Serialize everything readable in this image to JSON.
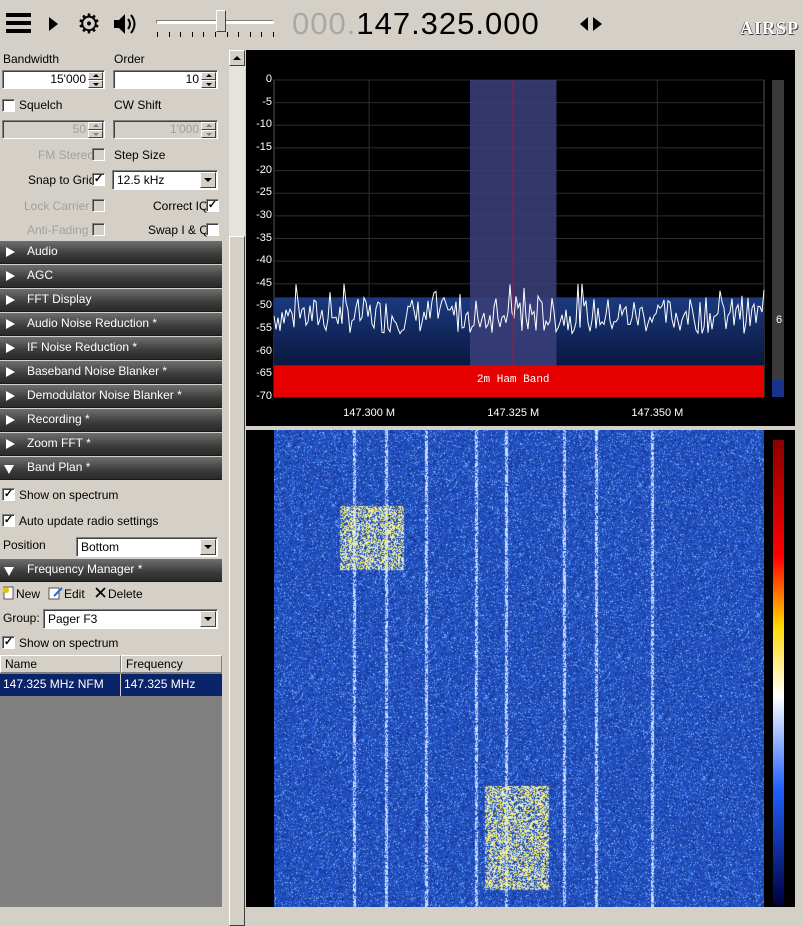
{
  "toolbar": {
    "freq_dim": "000.",
    "freq_main": "147.325.000",
    "brand": "AIRSP",
    "volume_level": 0.55
  },
  "settings": {
    "bandwidth_label": "Bandwidth",
    "bandwidth_value": "15'000",
    "order_label": "Order",
    "order_value": "10",
    "squelch_label": "Squelch",
    "squelch_checked": false,
    "squelch_value": "50",
    "cw_shift_label": "CW Shift",
    "cw_shift_value": "1'000",
    "fm_stereo_label": "FM Stereo",
    "step_size_label": "Step Size",
    "snap_label": "Snap to Grid",
    "snap_checked": true,
    "step_value": "12.5 kHz",
    "lock_carrier_label": "Lock Carrier",
    "correct_iq_label": "Correct IQ",
    "correct_iq_checked": true,
    "anti_fading_label": "Anti-Fading",
    "swap_iq_label": "Swap I & Q"
  },
  "sections": [
    "Audio",
    "AGC",
    "FFT Display",
    "Audio Noise Reduction *",
    "IF Noise Reduction *",
    "Baseband Noise Blanker *",
    "Demodulator Noise Blanker *",
    "Recording *",
    "Zoom FFT *",
    "Band Plan *"
  ],
  "band_plan": {
    "show_on_spectrum": "Show on spectrum",
    "auto_update": "Auto update radio settings",
    "position_label": "Position",
    "position_value": "Bottom"
  },
  "freq_manager": {
    "title": "Frequency Manager *",
    "new_label": "New",
    "edit_label": "Edit",
    "delete_label": "Delete",
    "group_label": "Group:",
    "group_value": "Pager F3",
    "show_on_spectrum": "Show on spectrum",
    "columns": [
      "Name",
      "Frequency"
    ],
    "rows": [
      {
        "name": "147.325 MHz NFM",
        "frequency": "147.325 MHz"
      }
    ]
  },
  "chart_data": {
    "type": "line",
    "title": "",
    "xlabel": "",
    "ylabel": "",
    "x_ticks": [
      "147.300 M",
      "147.325 M",
      "147.350 M"
    ],
    "x_tick_values": [
      147.3,
      147.325,
      147.35
    ],
    "xlim": [
      147.2835,
      147.3685
    ],
    "y_ticks": [
      "0",
      "-5",
      "-10",
      "-15",
      "-20",
      "-25",
      "-30",
      "-35",
      "-40",
      "-45",
      "-50",
      "-55",
      "-60",
      "-65",
      "-70"
    ],
    "ylim": [
      -70,
      0
    ],
    "grid": true,
    "noise_floor_db": -52,
    "peak_db": -45,
    "center_mhz": 147.325,
    "filter_band_mhz": [
      147.3175,
      147.3325
    ],
    "band_label": "2m Ham Band",
    "db_readout": "6"
  },
  "colors": {
    "accent_red": "#e60000",
    "filter_band": "#3b3f7a",
    "waterfall_bg": "#1f43a8",
    "section_bg": "#3c3c3c",
    "selection": "#0a246a"
  }
}
